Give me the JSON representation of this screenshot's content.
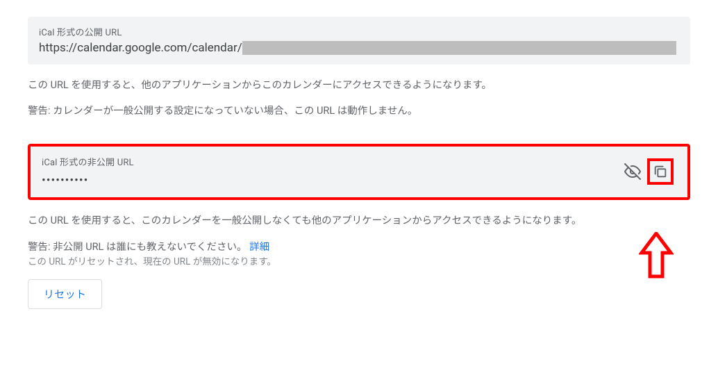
{
  "public": {
    "label": "iCal 形式の公開 URL",
    "url_visible": "https://calendar.google.com/calendar/",
    "desc1": "この URL を使用すると、他のアプリケーションからこのカレンダーにアクセスできるようになります。",
    "desc2": "警告: カレンダーが一般公開する設定になっていない場合、この URL は動作しません。"
  },
  "private": {
    "label": "iCal 形式の非公開 URL",
    "value_masked": "••••••••••",
    "desc1": "この URL を使用すると、このカレンダーを一般公開しなくても他のアプリケーションからアクセスできるようになります。",
    "warning_prefix": "警告: 非公開 URL は誰にも教えないでください。",
    "details_link": "詳細",
    "helper": "この URL がリセットされ、現在の URL が無効になります。",
    "reset_label": "リセット"
  },
  "icons": {
    "visibility_off": "eye-off-icon",
    "copy": "copy-icon"
  }
}
